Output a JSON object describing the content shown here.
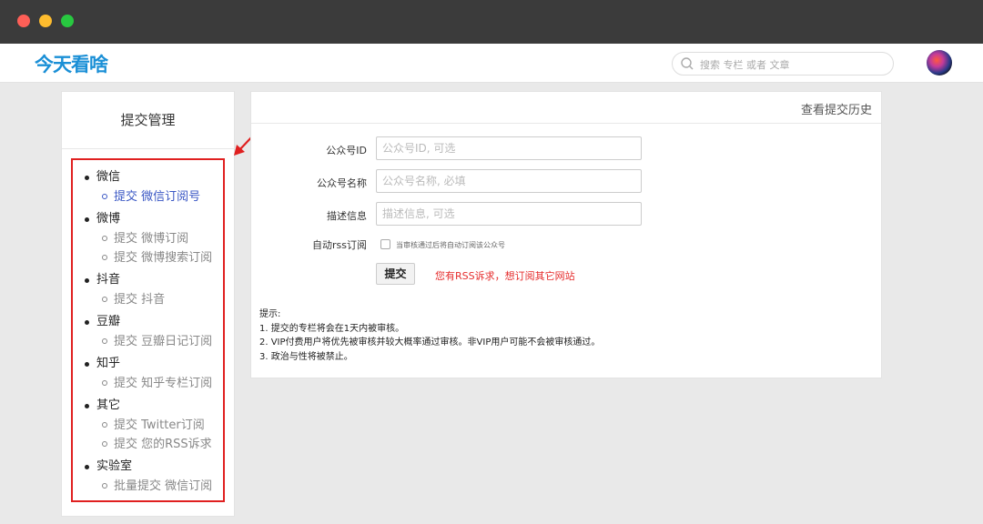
{
  "app": {
    "logo": "今天看啥",
    "search_placeholder": "搜索 专栏 或者 文章"
  },
  "sidebar": {
    "title": "提交管理",
    "groups": [
      {
        "label": "微信",
        "items": [
          "提交 微信订阅号"
        ]
      },
      {
        "label": "微博",
        "items": [
          "提交 微博订阅",
          "提交 微博搜索订阅"
        ]
      },
      {
        "label": "抖音",
        "items": [
          "提交 抖音"
        ]
      },
      {
        "label": "豆瓣",
        "items": [
          "提交 豆瓣日记订阅"
        ]
      },
      {
        "label": "知乎",
        "items": [
          "提交 知乎专栏订阅"
        ]
      },
      {
        "label": "其它",
        "items": [
          "提交 Twitter订阅",
          "提交 您的RSS诉求"
        ]
      },
      {
        "label": "实验室",
        "items": [
          "批量提交 微信订阅"
        ]
      }
    ]
  },
  "main": {
    "history_link": "查看提交历史",
    "fields": [
      {
        "label": "公众号ID",
        "placeholder": "公众号ID, 可选",
        "value": ""
      },
      {
        "label": "公众号名称",
        "placeholder": "公众号名称, 必填",
        "value": ""
      },
      {
        "label": "描述信息",
        "placeholder": "描述信息, 可选",
        "value": ""
      }
    ],
    "rss_label": "自动rss订阅",
    "rss_checkbox_text": "当审核通过后将自动订阅该公众号",
    "rss_checked": false,
    "submit_label": "提交",
    "rss_request_link": "您有RSS诉求，想订阅其它网站",
    "tips_title": "提示:",
    "tips": [
      "1. 提交的专栏将会在1天内被审核。",
      "2. VIP付费用户将优先被审核并较大概率通过审核。非VIP用户可能不会被审核通过。",
      "3. 政治与性将被禁止。"
    ]
  },
  "colors": {
    "accent": "#1a8fd6",
    "highlight": "#e02020",
    "active_link": "#3a57c4",
    "warning_link": "#e52b2b"
  }
}
